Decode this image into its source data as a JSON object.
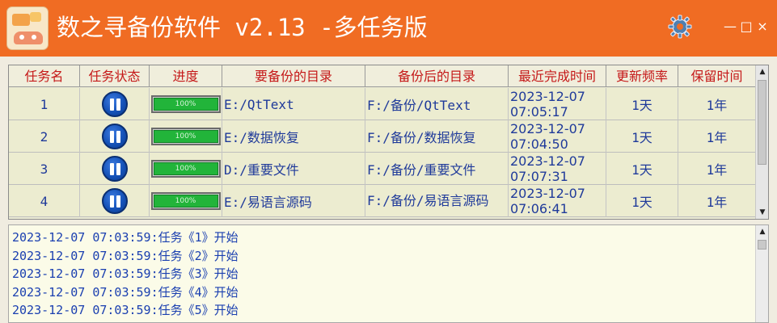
{
  "window": {
    "title": "数之寻备份软件 v2.13 -多任务版",
    "controls": {
      "minimize": "—",
      "maximize": "□",
      "close": "×"
    },
    "colors": {
      "titlebar": "#f06c23",
      "header_text": "#c51818",
      "cell_text": "#1f3a9a",
      "progress_fill": "#22b43a"
    }
  },
  "table": {
    "headers": [
      "任务名",
      "任务状态",
      "进度",
      "要备份的目录",
      "备份后的目录",
      "最近完成时间",
      "更新频率",
      "保留时间"
    ],
    "rows": [
      {
        "name": "1",
        "status_icon": "pause-icon",
        "progress": "100%",
        "progress_value": 100,
        "source": "E:/QtText",
        "dest": "F:/备份/QtText",
        "time_date": "2023-12-07",
        "time_clock": "07:05:17",
        "freq": "1天",
        "keep": "1年"
      },
      {
        "name": "2",
        "status_icon": "pause-icon",
        "progress": "100%",
        "progress_value": 100,
        "source": "E:/数据恢复",
        "dest": "F:/备份/数据恢复",
        "time_date": "2023-12-07",
        "time_clock": "07:04:50",
        "freq": "1天",
        "keep": "1年"
      },
      {
        "name": "3",
        "status_icon": "pause-icon",
        "progress": "100%",
        "progress_value": 100,
        "source": "D:/重要文件",
        "dest": "F:/备份/重要文件",
        "time_date": "2023-12-07",
        "time_clock": "07:07:31",
        "freq": "1天",
        "keep": "1年"
      },
      {
        "name": "4",
        "status_icon": "pause-icon",
        "progress": "100%",
        "progress_value": 100,
        "source": "E:/易语言源码",
        "dest": "F:/备份/易语言源码",
        "time_date": "2023-12-07",
        "time_clock": "07:06:41",
        "freq": "1天",
        "keep": "1年"
      }
    ]
  },
  "log": {
    "lines": [
      "2023-12-07 07:03:59:任务《1》开始",
      "2023-12-07 07:03:59:任务《2》开始",
      "2023-12-07 07:03:59:任务《3》开始",
      "2023-12-07 07:03:59:任务《4》开始",
      "2023-12-07 07:03:59:任务《5》开始"
    ]
  },
  "scrollbar": {
    "up": "▲",
    "down": "▼"
  }
}
